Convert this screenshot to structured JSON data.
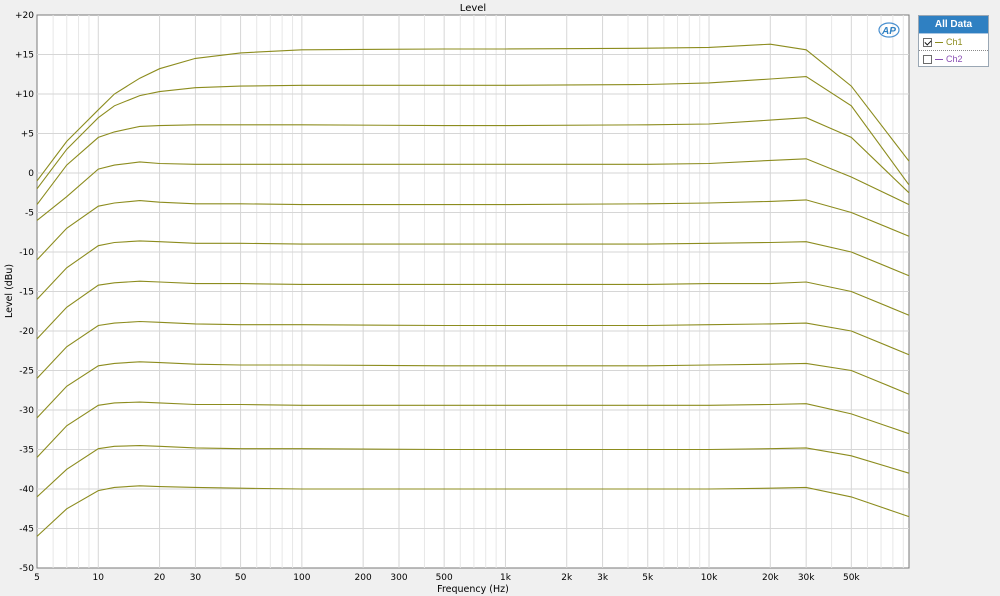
{
  "chart_data": {
    "type": "line",
    "title": "Level",
    "xlabel": "Frequency (Hz)",
    "ylabel": "Level (dBu)",
    "x_scale": "log",
    "xlim": [
      5,
      96000
    ],
    "ylim": [
      -50,
      20
    ],
    "grid": true,
    "x_tick_values": [
      5,
      10,
      20,
      30,
      50,
      100,
      200,
      300,
      500,
      1000,
      2000,
      3000,
      5000,
      10000,
      20000,
      30000,
      50000
    ],
    "x_tick_labels": [
      "5",
      "10",
      "20",
      "30",
      "50",
      "100",
      "200",
      "300",
      "500",
      "1k",
      "2k",
      "3k",
      "5k",
      "10k",
      "20k",
      "30k",
      "50k"
    ],
    "y_tick_values": [
      20,
      15,
      10,
      5,
      0,
      -5,
      -10,
      -15,
      -20,
      -25,
      -30,
      -35,
      -40,
      -45,
      -50
    ],
    "y_tick_labels": [
      "+20",
      "+15",
      "+10",
      "+5",
      "0",
      "-5",
      "-10",
      "-15",
      "-20",
      "-25",
      "-30",
      "-35",
      "-40",
      "-45",
      "-50"
    ],
    "series": [
      {
        "name": "Ch1",
        "color": "#8c8c1e",
        "x": [
          5,
          7,
          10,
          12,
          16,
          20,
          30,
          50,
          100,
          500,
          1000,
          5000,
          10000,
          20000,
          30000,
          50000,
          96000
        ],
        "y": [
          -1,
          4,
          8,
          10,
          12,
          13.2,
          14.5,
          15.2,
          15.6,
          15.7,
          15.7,
          15.8,
          15.9,
          16.3,
          15.6,
          11,
          1.5
        ]
      },
      {
        "name": "Ch1",
        "color": "#8c8c1e",
        "x": [
          5,
          7,
          10,
          12,
          16,
          20,
          30,
          50,
          100,
          500,
          1000,
          5000,
          10000,
          20000,
          30000,
          50000,
          96000
        ],
        "y": [
          -2,
          3,
          7,
          8.5,
          9.8,
          10.3,
          10.8,
          11,
          11.1,
          11.1,
          11.1,
          11.2,
          11.4,
          11.9,
          12.2,
          8.5,
          -1.5
        ]
      },
      {
        "name": "Ch1",
        "color": "#8c8c1e",
        "x": [
          5,
          7,
          10,
          12,
          16,
          20,
          30,
          50,
          100,
          500,
          1000,
          5000,
          10000,
          20000,
          30000,
          50000,
          96000
        ],
        "y": [
          -4,
          1,
          4.5,
          5.2,
          5.9,
          6,
          6.1,
          6.1,
          6.1,
          6,
          6,
          6.1,
          6.2,
          6.7,
          7,
          4.5,
          -2.5
        ]
      },
      {
        "name": "Ch1",
        "color": "#8c8c1e",
        "x": [
          5,
          7,
          10,
          12,
          16,
          20,
          30,
          50,
          100,
          500,
          1000,
          5000,
          10000,
          20000,
          30000,
          50000,
          96000
        ],
        "y": [
          -6,
          -3,
          0.5,
          1,
          1.4,
          1.2,
          1.1,
          1.1,
          1.1,
          1.1,
          1.1,
          1.1,
          1.2,
          1.6,
          1.8,
          -0.5,
          -4
        ]
      },
      {
        "name": "Ch1",
        "color": "#8c8c1e",
        "x": [
          5,
          7,
          10,
          12,
          16,
          20,
          30,
          50,
          100,
          500,
          1000,
          5000,
          10000,
          20000,
          30000,
          50000,
          96000
        ],
        "y": [
          -11,
          -7,
          -4.2,
          -3.8,
          -3.5,
          -3.7,
          -3.9,
          -3.9,
          -4,
          -4,
          -4,
          -3.9,
          -3.8,
          -3.6,
          -3.4,
          -5,
          -8
        ]
      },
      {
        "name": "Ch1",
        "color": "#8c8c1e",
        "x": [
          5,
          7,
          10,
          12,
          16,
          20,
          30,
          50,
          100,
          500,
          1000,
          5000,
          10000,
          20000,
          30000,
          50000,
          96000
        ],
        "y": [
          -16,
          -12,
          -9.2,
          -8.8,
          -8.6,
          -8.7,
          -8.9,
          -8.9,
          -9,
          -9,
          -9,
          -9,
          -8.9,
          -8.8,
          -8.7,
          -10,
          -13
        ]
      },
      {
        "name": "Ch1",
        "color": "#8c8c1e",
        "x": [
          5,
          7,
          10,
          12,
          16,
          20,
          30,
          50,
          100,
          500,
          1000,
          5000,
          10000,
          20000,
          30000,
          50000,
          96000
        ],
        "y": [
          -21,
          -17,
          -14.2,
          -13.9,
          -13.7,
          -13.8,
          -14,
          -14,
          -14.1,
          -14.1,
          -14.1,
          -14.1,
          -14,
          -14,
          -13.8,
          -15,
          -18
        ]
      },
      {
        "name": "Ch1",
        "color": "#8c8c1e",
        "x": [
          5,
          7,
          10,
          12,
          16,
          20,
          30,
          50,
          100,
          500,
          1000,
          5000,
          10000,
          20000,
          30000,
          50000,
          96000
        ],
        "y": [
          -26,
          -22,
          -19.3,
          -19,
          -18.8,
          -18.9,
          -19.1,
          -19.2,
          -19.2,
          -19.3,
          -19.3,
          -19.3,
          -19.2,
          -19.1,
          -19,
          -20,
          -23
        ]
      },
      {
        "name": "Ch1",
        "color": "#8c8c1e",
        "x": [
          5,
          7,
          10,
          12,
          16,
          20,
          30,
          50,
          100,
          500,
          1000,
          5000,
          10000,
          20000,
          30000,
          50000,
          96000
        ],
        "y": [
          -31,
          -27,
          -24.4,
          -24.1,
          -23.9,
          -24,
          -24.2,
          -24.3,
          -24.3,
          -24.4,
          -24.4,
          -24.4,
          -24.3,
          -24.2,
          -24.1,
          -25,
          -28
        ]
      },
      {
        "name": "Ch1",
        "color": "#8c8c1e",
        "x": [
          5,
          7,
          10,
          12,
          16,
          20,
          30,
          50,
          100,
          500,
          1000,
          5000,
          10000,
          20000,
          30000,
          50000,
          96000
        ],
        "y": [
          -36,
          -32,
          -29.4,
          -29.1,
          -29,
          -29.1,
          -29.3,
          -29.3,
          -29.4,
          -29.4,
          -29.4,
          -29.4,
          -29.4,
          -29.3,
          -29.2,
          -30.5,
          -33
        ]
      },
      {
        "name": "Ch1",
        "color": "#8c8c1e",
        "x": [
          5,
          7,
          10,
          12,
          16,
          20,
          30,
          50,
          100,
          500,
          1000,
          5000,
          10000,
          20000,
          30000,
          50000,
          96000
        ],
        "y": [
          -41,
          -37.5,
          -34.9,
          -34.6,
          -34.5,
          -34.6,
          -34.8,
          -34.9,
          -34.9,
          -35,
          -35,
          -35,
          -35,
          -34.9,
          -34.8,
          -35.8,
          -38
        ]
      },
      {
        "name": "Ch1",
        "color": "#8c8c1e",
        "x": [
          5,
          7,
          10,
          12,
          16,
          20,
          30,
          50,
          100,
          500,
          1000,
          5000,
          10000,
          20000,
          30000,
          50000,
          96000
        ],
        "y": [
          -46,
          -42.5,
          -40.2,
          -39.8,
          -39.6,
          -39.7,
          -39.8,
          -39.9,
          -40,
          -40,
          -40,
          -40,
          -40,
          -39.9,
          -39.8,
          -41,
          -43.5
        ]
      }
    ]
  },
  "legend": {
    "header": "All Data",
    "items": [
      {
        "label": "Ch1",
        "checked": true,
        "color": "#8c8c1e"
      },
      {
        "label": "Ch2",
        "checked": false,
        "color": "#8a4fb5"
      }
    ]
  },
  "logo_text": "AP",
  "colors": {
    "plot_background": "#ffffff",
    "header_blue": "#2f80c2"
  }
}
